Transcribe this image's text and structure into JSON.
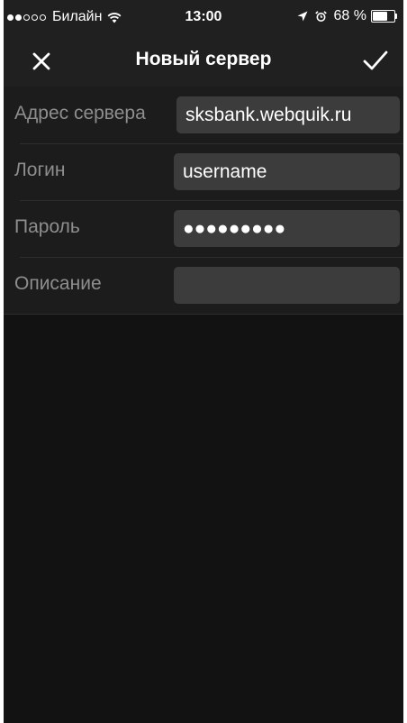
{
  "status_bar": {
    "signal_full": 2,
    "signal_total": 5,
    "carrier": "Билайн",
    "time": "13:00",
    "battery_text": "68 %",
    "battery_level": 0.68,
    "icons": [
      "wifi-icon",
      "location-arrow-icon",
      "alarm-clock-icon",
      "battery-icon"
    ]
  },
  "nav": {
    "title": "Новый сервер",
    "close_icon": "close-icon",
    "done_icon": "checkmark-icon"
  },
  "form": {
    "fields": [
      {
        "label": "Адрес сервера",
        "value": "sksbank.webquik.ru",
        "type": "text"
      },
      {
        "label": "Логин",
        "value": "username",
        "type": "text"
      },
      {
        "label": "Пароль",
        "value": "●●●●●●●●●",
        "type": "password"
      },
      {
        "label": "Описание",
        "value": "",
        "type": "text"
      }
    ]
  },
  "colors": {
    "background": "#121212",
    "bar": "#202020",
    "form_background": "#1c1c1c",
    "input_background": "#3c3c3c",
    "label": "#8e8e8e",
    "text": "#ffffff"
  }
}
